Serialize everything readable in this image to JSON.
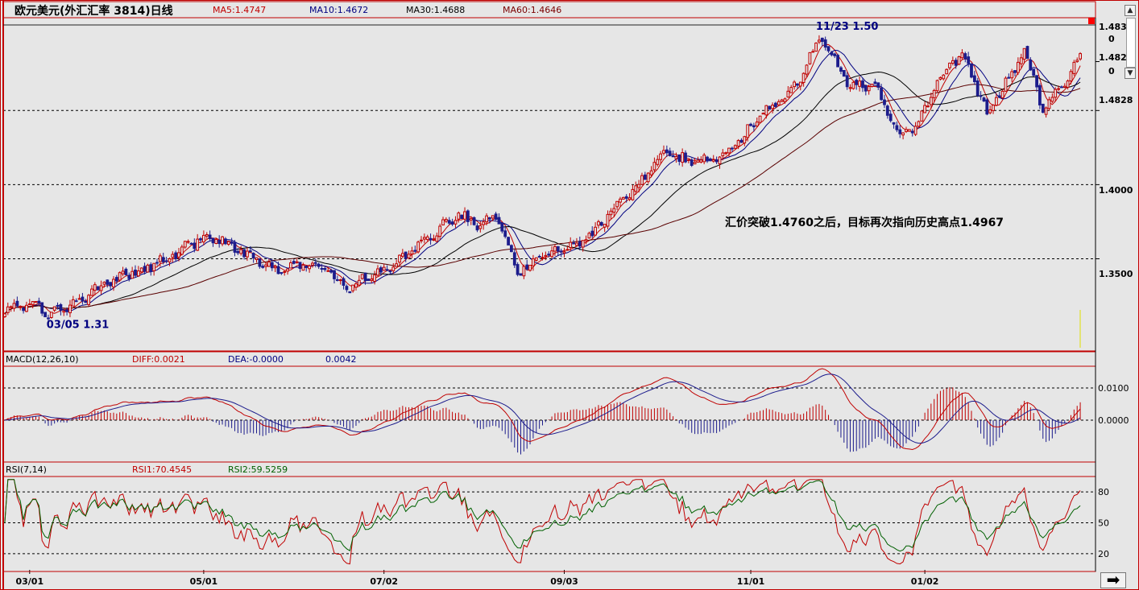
{
  "window": {
    "title": "欧元美元(外汇汇率 3814)日线",
    "ma_readouts": [
      {
        "label": "MA5:1.4747",
        "color": "#c00000"
      },
      {
        "label": "MA10:1.4672",
        "color": "#000080"
      },
      {
        "label": "MA30:1.4688",
        "color": "#000000"
      },
      {
        "label": "MA60:1.4646",
        "color": "#7a0000"
      }
    ],
    "scrollbar": {
      "up": "▲",
      "down": "▼"
    }
  },
  "colors": {
    "up": "#c00000",
    "down": "#1c1c8c",
    "ma5": "#c00000",
    "ma10": "#000080",
    "ma30": "#000000",
    "ma60": "#5a0000",
    "rsi1": "#c00000",
    "rsi2": "#006000",
    "panel_border": "#c00000",
    "grid": "#000000"
  },
  "chart_data": [
    {
      "type": "candlestick",
      "title": "欧元美元(外汇汇率 3814)日线",
      "ylim": [
        1.29,
        1.505
      ],
      "yticks": [
        1.35,
        1.4,
        1.4828,
        1.4828,
        1.483
      ],
      "ytick_labels": [
        "1.3500",
        "1.4000",
        "1.4828",
        "1.4828",
        "1.4830"
      ],
      "ytick_extra": [
        "0",
        "0"
      ],
      "grid": {
        "horizontal_dashed": [
          1.35,
          1.4,
          1.45
        ]
      },
      "x_labels": [
        "03/01",
        "05/01",
        "07/02",
        "09/03",
        "11/01",
        "01/02"
      ],
      "x_label_index": [
        8,
        64,
        122,
        180,
        240,
        296
      ],
      "n_bars": 347,
      "anchors": [
        {
          "i": 0,
          "v": 1.315
        },
        {
          "i": 10,
          "v": 1.322
        },
        {
          "i": 14,
          "v": 1.311
        },
        {
          "i": 24,
          "v": 1.322
        },
        {
          "i": 32,
          "v": 1.333
        },
        {
          "i": 50,
          "v": 1.348
        },
        {
          "i": 62,
          "v": 1.362
        },
        {
          "i": 68,
          "v": 1.364
        },
        {
          "i": 76,
          "v": 1.355
        },
        {
          "i": 88,
          "v": 1.343
        },
        {
          "i": 100,
          "v": 1.348
        },
        {
          "i": 110,
          "v": 1.329
        },
        {
          "i": 116,
          "v": 1.338
        },
        {
          "i": 124,
          "v": 1.343
        },
        {
          "i": 134,
          "v": 1.361
        },
        {
          "i": 146,
          "v": 1.38
        },
        {
          "i": 152,
          "v": 1.372
        },
        {
          "i": 158,
          "v": 1.378
        },
        {
          "i": 165,
          "v": 1.34
        },
        {
          "i": 172,
          "v": 1.352
        },
        {
          "i": 186,
          "v": 1.361
        },
        {
          "i": 200,
          "v": 1.392
        },
        {
          "i": 212,
          "v": 1.42
        },
        {
          "i": 222,
          "v": 1.415
        },
        {
          "i": 232,
          "v": 1.42
        },
        {
          "i": 246,
          "v": 1.452
        },
        {
          "i": 256,
          "v": 1.47
        },
        {
          "i": 262,
          "v": 1.5
        },
        {
          "i": 272,
          "v": 1.465
        },
        {
          "i": 280,
          "v": 1.468
        },
        {
          "i": 288,
          "v": 1.432
        },
        {
          "i": 294,
          "v": 1.44
        },
        {
          "i": 300,
          "v": 1.47
        },
        {
          "i": 308,
          "v": 1.49
        },
        {
          "i": 316,
          "v": 1.448
        },
        {
          "i": 324,
          "v": 1.475
        },
        {
          "i": 328,
          "v": 1.49
        },
        {
          "i": 334,
          "v": 1.452
        },
        {
          "i": 342,
          "v": 1.47
        },
        {
          "i": 346,
          "v": 1.488
        }
      ],
      "annotations": [
        {
          "text": "03/05 1.31",
          "i": 15,
          "v": 1.311,
          "pos": "below"
        },
        {
          "text": "11/23 1.50",
          "i": 262,
          "v": 1.5,
          "pos": "above"
        },
        {
          "text": "汇价突破1.4760之后，目标再次指向历史高点1.4967",
          "i": 232,
          "v": 1.372,
          "pos": "text"
        }
      ]
    },
    {
      "type": "macd",
      "name": "MACD(12,26,10)",
      "readouts": [
        {
          "label": "MACD(12,26,10)",
          "color": "#000000"
        },
        {
          "label": "DIFF:0.0021",
          "color": "#c00000"
        },
        {
          "label": "DEA:-0.0000",
          "color": "#000080"
        },
        {
          "label": "0.0042",
          "color": "#000080"
        }
      ],
      "ylim": [
        -0.0125,
        0.0165
      ],
      "yticks": [
        0.0,
        0.01
      ],
      "ytick_labels": [
        "0.0000",
        "0.0100"
      ]
    },
    {
      "type": "rsi",
      "name": "RSI(7,14)",
      "readouts": [
        {
          "label": "RSI(7,14)",
          "color": "#000000"
        },
        {
          "label": "RSI1:70.4545",
          "color": "#c00000"
        },
        {
          "label": "RSI2:59.5259",
          "color": "#006000"
        }
      ],
      "ylim": [
        5,
        95
      ],
      "yticks": [
        20,
        50,
        80
      ],
      "ytick_labels": [
        "20",
        "50",
        "80"
      ]
    }
  ]
}
